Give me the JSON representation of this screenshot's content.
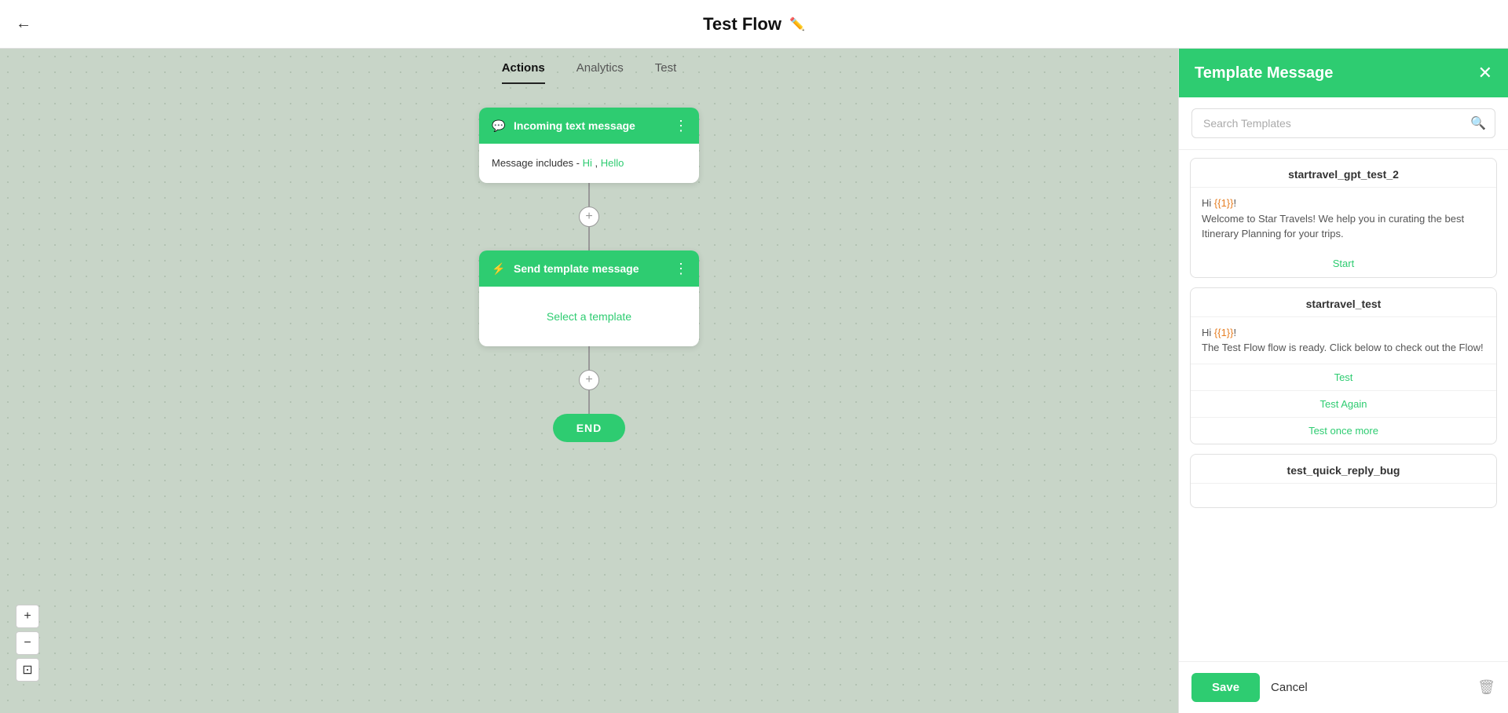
{
  "topbar": {
    "back_icon": "←",
    "title": "Test Flow",
    "edit_icon": "✏️"
  },
  "tabs": [
    {
      "label": "Actions",
      "active": true
    },
    {
      "label": "Analytics",
      "active": false
    },
    {
      "label": "Test",
      "active": false
    }
  ],
  "flow": {
    "node_incoming": {
      "icon": "💬",
      "title": "Incoming text message",
      "menu_icon": "⋮",
      "body": "Message includes - ",
      "highlights": [
        "Hi",
        "Hello"
      ]
    },
    "connector1": {
      "plus": "+"
    },
    "node_send": {
      "icon": "⚡",
      "title": "Send template message",
      "menu_icon": "⋮",
      "select_label": "Select a template"
    },
    "connector2": {
      "plus": "+"
    },
    "end_label": "END"
  },
  "zoom": {
    "in": "+",
    "out": "−",
    "fit": "⊡"
  },
  "panel": {
    "title": "Template Message",
    "close_icon": "✕",
    "search_placeholder": "Search Templates",
    "templates": [
      {
        "name": "startravel_gpt_test_2",
        "body_parts": [
          {
            "text": "Hi ",
            "type": "normal"
          },
          {
            "text": "{{1}}",
            "type": "placeholder"
          },
          {
            "text": "!\nWelcome to Star Travels! We help you in curating the best Itinerary Planning for your trips.",
            "type": "normal"
          }
        ],
        "actions": [
          {
            "label": "Start",
            "type": "single"
          }
        ]
      },
      {
        "name": "startravel_test",
        "body_parts": [
          {
            "text": "Hi ",
            "type": "normal"
          },
          {
            "text": "{{1}}",
            "type": "placeholder"
          },
          {
            "text": "!\nThe Test Flow flow is ready. Click below to check out the Flow!",
            "type": "normal"
          }
        ],
        "actions": [
          {
            "label": "Test",
            "type": "multi"
          },
          {
            "label": "Test Again",
            "type": "multi"
          },
          {
            "label": "Test once more",
            "type": "multi"
          }
        ]
      },
      {
        "name": "test_quick_reply_bug",
        "body_parts": [
          {
            "text": "",
            "type": "normal"
          }
        ],
        "actions": []
      }
    ],
    "footer": {
      "save_label": "Save",
      "cancel_label": "Cancel",
      "delete_icon": "🗑"
    }
  }
}
